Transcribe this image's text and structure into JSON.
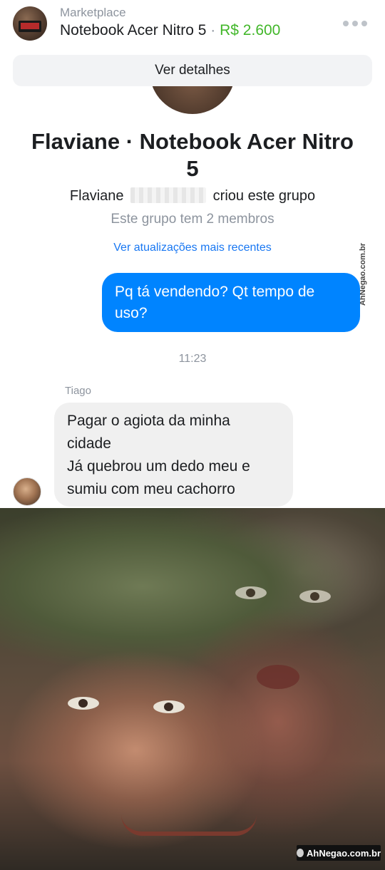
{
  "header": {
    "kicker": "Marketplace",
    "listing_title": "Notebook Acer Nitro 5",
    "separator": "·",
    "price": "R$ 2.600",
    "details_button": "Ver detalhes",
    "price_color": "#42b72a"
  },
  "group": {
    "title": "Flaviane · Notebook Acer Nitro 5",
    "creator_first_name": "Flaviane",
    "creator_suffix": "criou este grupo",
    "members_text": "Este grupo tem 2 membros",
    "updates_link": "Ver atualizações mais recentes"
  },
  "messages": {
    "outgoing_text": "Pq tá vendendo? Qt tempo de uso?",
    "timestamp": "11:23",
    "incoming_sender": "Tiago",
    "incoming_lines": [
      "Pagar o agiota da minha",
      "cidade",
      "Já quebrou um dedo meu e",
      "sumiu com meu cachorro"
    ],
    "outgoing_color": "#0084ff"
  },
  "watermarks": {
    "vertical": "AhNegao.com.br",
    "badge": "AhNegao.com.br"
  },
  "icons": {
    "more": "more-horizontal-icon"
  }
}
